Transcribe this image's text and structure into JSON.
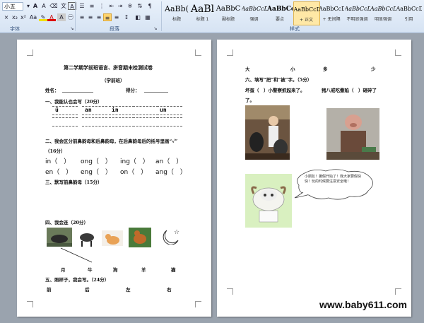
{
  "ribbon": {
    "font_name": "小五",
    "font_group_label": "字体",
    "paragraph_group_label": "段落",
    "styles_group_label": "样式",
    "styles": [
      {
        "preview": "AaBb(",
        "name": "标题"
      },
      {
        "preview": "AaBl",
        "name": "标题 1"
      },
      {
        "preview": "AaBbC",
        "name": "副标题"
      },
      {
        "preview": "AaBbCcDc",
        "name": "强调"
      },
      {
        "preview": "AaBbCcD",
        "name": "要点"
      },
      {
        "preview": "AaBbCcDc",
        "name": "+ 正文"
      },
      {
        "preview": "AaBbCcDc",
        "name": "+ 无间隔"
      },
      {
        "preview": "AaBbCcDc",
        "name": "不明显强调"
      },
      {
        "preview": "AaBbCcDc",
        "name": "明显强调"
      },
      {
        "preview": "AaBbCcDc",
        "name": "引用"
      }
    ]
  },
  "page1": {
    "title": "第二学期学前班语言、拼音期末检测试卷",
    "subtitle": "（学前班）",
    "name_label": "姓名：",
    "score_label": "得分：",
    "q1": "一、我能认也会写（20分）",
    "pinyin": [
      "ü",
      "an",
      "in",
      "",
      "un"
    ],
    "q2": "二、我会区分前鼻韵母和后鼻韵母，在后鼻韵母后的括号里画“√”",
    "q2_score": "（16分）",
    "row1": [
      "in（　）",
      "ong（　）",
      "ing（　）",
      "an（　）"
    ],
    "row2": [
      "en（　）",
      "eng（　）",
      "on（　）",
      "ang（　）"
    ],
    "q3": "三、默写前鼻韵母（15分）",
    "q4": "四、我会连（20分）",
    "animals": [
      "月",
      "牛",
      "狗",
      "羊",
      "猫"
    ],
    "q5": "五、照样子，我会写。（24分）",
    "q5_words": [
      "前",
      "后",
      "左",
      "右"
    ]
  },
  "page2": {
    "top_words": [
      "大",
      "小",
      "多",
      "少"
    ],
    "q6": "六、填写“把”和“被”字。（5分）",
    "s1a": "坏蛋（　）小警察抓起来了。",
    "s1b": "猪八戒吃撒陷（　）砸碎了",
    "s1c": "了。",
    "bubble": "小朋友！暑假开始了！我大家要假快快！玩的时候要注意安全哦！"
  },
  "watermark": "www.baby611.com",
  "colors": {
    "ribbon": "#dfe9f6",
    "canvas": "#9aa3ae",
    "highlight": "#ffe8a6"
  }
}
